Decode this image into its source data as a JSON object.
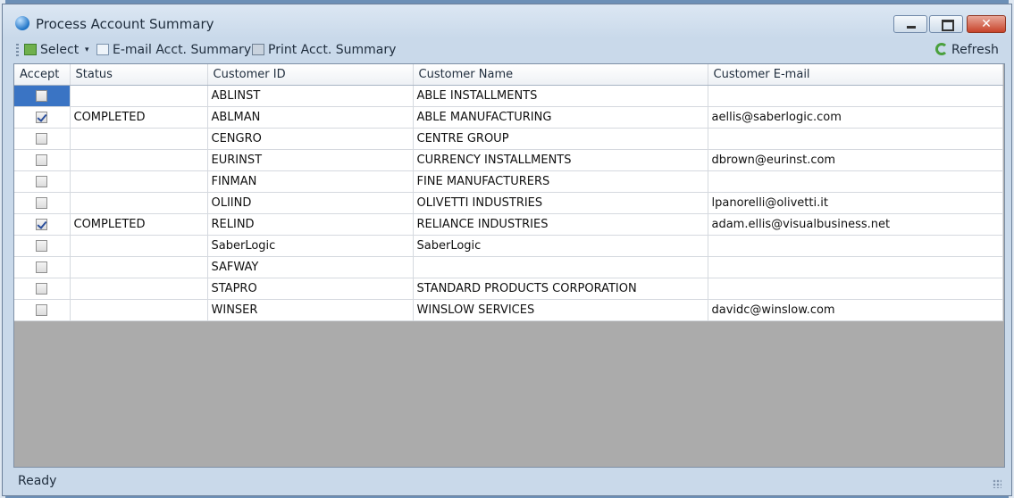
{
  "window": {
    "title": "Process Account Summary"
  },
  "toolbar": {
    "select_label": "Select",
    "email_label": "E-mail Acct. Summary",
    "print_label": "Print Acct. Summary",
    "refresh_label": "Refresh"
  },
  "columns": [
    "Accept",
    "Status",
    "Customer ID",
    "Customer Name",
    "Customer E-mail"
  ],
  "rows": [
    {
      "accept": false,
      "status": "",
      "id": "ABLINST",
      "name": "ABLE INSTALLMENTS",
      "email": ""
    },
    {
      "accept": true,
      "status": "COMPLETED",
      "id": "ABLMAN",
      "name": "ABLE MANUFACTURING",
      "email": "aellis@saberlogic.com"
    },
    {
      "accept": false,
      "status": "",
      "id": "CENGRO",
      "name": "CENTRE GROUP",
      "email": ""
    },
    {
      "accept": false,
      "status": "",
      "id": "EURINST",
      "name": "CURRENCY INSTALLMENTS",
      "email": "dbrown@eurinst.com"
    },
    {
      "accept": false,
      "status": "",
      "id": "FINMAN",
      "name": "FINE MANUFACTURERS",
      "email": ""
    },
    {
      "accept": false,
      "status": "",
      "id": "OLIIND",
      "name": "OLIVETTI INDUSTRIES",
      "email": "lpanorelli@olivetti.it"
    },
    {
      "accept": true,
      "status": "COMPLETED",
      "id": "RELIND",
      "name": "RELIANCE INDUSTRIES",
      "email": "adam.ellis@visualbusiness.net"
    },
    {
      "accept": false,
      "status": "",
      "id": "SaberLogic",
      "name": "SaberLogic",
      "email": ""
    },
    {
      "accept": false,
      "status": "",
      "id": "SAFWAY",
      "name": "",
      "email": ""
    },
    {
      "accept": false,
      "status": "",
      "id": "STAPRO",
      "name": "STANDARD PRODUCTS CORPORATION",
      "email": ""
    },
    {
      "accept": false,
      "status": "",
      "id": "WINSER",
      "name": "WINSLOW SERVICES",
      "email": "davidc@winslow.com"
    }
  ],
  "statusbar": {
    "text": "Ready"
  }
}
